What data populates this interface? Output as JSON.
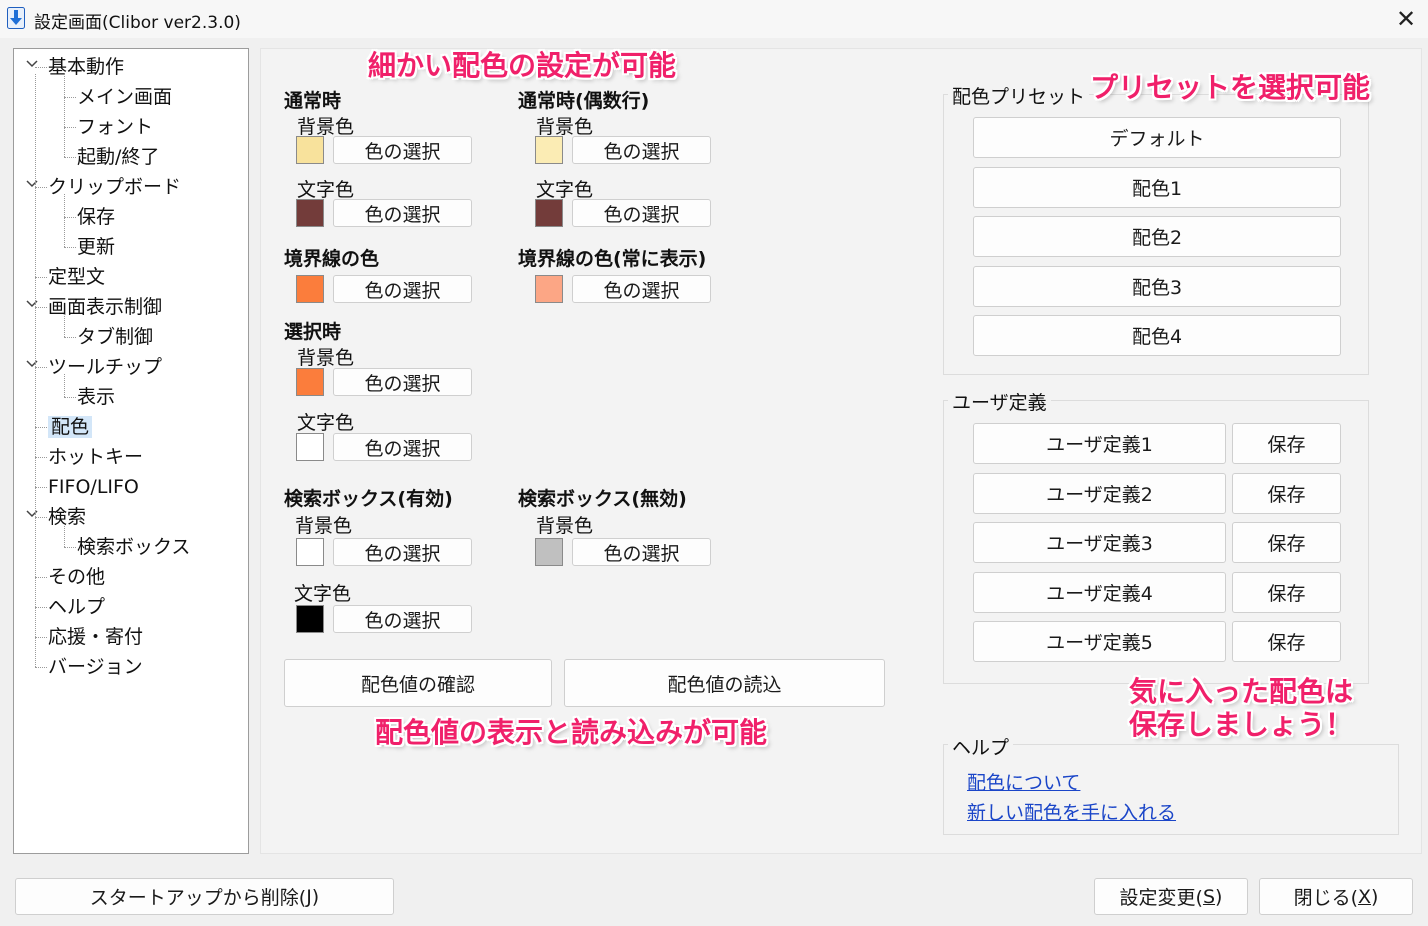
{
  "window": {
    "title": "設定画面(Clibor ver2.3.0)",
    "close_glyph": "✕"
  },
  "tree": [
    {
      "label": "基本動作",
      "level": 0,
      "expanded": true
    },
    {
      "label": "メイン画面",
      "level": 1
    },
    {
      "label": "フォント",
      "level": 1
    },
    {
      "label": "起動/終了",
      "level": 1
    },
    {
      "label": "クリップボード",
      "level": 0,
      "expanded": true
    },
    {
      "label": "保存",
      "level": 1
    },
    {
      "label": "更新",
      "level": 1
    },
    {
      "label": "定型文",
      "level": 0
    },
    {
      "label": "画面表示制御",
      "level": 0,
      "expanded": true
    },
    {
      "label": "タブ制御",
      "level": 1
    },
    {
      "label": "ツールチップ",
      "level": 0,
      "expanded": true
    },
    {
      "label": "表示",
      "level": 1
    },
    {
      "label": "配色",
      "level": 0,
      "selected": true
    },
    {
      "label": "ホットキー",
      "level": 0
    },
    {
      "label": "FIFO/LIFO",
      "level": 0
    },
    {
      "label": "検索",
      "level": 0,
      "expanded": true
    },
    {
      "label": "検索ボックス",
      "level": 1
    },
    {
      "label": "その他",
      "level": 0
    },
    {
      "label": "ヘルプ",
      "level": 0
    },
    {
      "label": "応援・寄付",
      "level": 0
    },
    {
      "label": "バージョン",
      "level": 0
    }
  ],
  "colors": {
    "normal": {
      "heading": "通常時",
      "bg_label": "背景色",
      "bg": "#f8e29c",
      "fg_label": "文字色",
      "fg": "#733c3a"
    },
    "normal_even": {
      "heading": "通常時(偶数行)",
      "bg_label": "背景色",
      "bg": "#fbecb4",
      "fg_label": "文字色",
      "fg": "#733c3a"
    },
    "border": {
      "heading": "境界線の色",
      "color": "#fb7d3c"
    },
    "border_always": {
      "heading": "境界線の色(常に表示)",
      "color": "#fca685"
    },
    "selected": {
      "heading": "選択時",
      "bg_label": "背景色",
      "bg": "#fb7d3c",
      "fg_label": "文字色",
      "fg": "#ffffff"
    },
    "search_enabled": {
      "heading": "検索ボックス(有効)",
      "bg_label": "背景色",
      "bg": "#ffffff",
      "fg_label": "文字色",
      "fg": "#000000"
    },
    "search_disabled": {
      "heading": "検索ボックス(無効)",
      "bg_label": "背景色",
      "bg": "#c0c0c0"
    },
    "choose_label": "色の選択"
  },
  "actions": {
    "confirm": "配色値の確認",
    "load": "配色値の読込"
  },
  "preset": {
    "label": "配色プリセット",
    "items": [
      "デフォルト",
      "配色1",
      "配色2",
      "配色3",
      "配色4"
    ]
  },
  "user": {
    "label": "ユーザ定義",
    "items": [
      "ユーザ定義1",
      "ユーザ定義2",
      "ユーザ定義3",
      "ユーザ定義4",
      "ユーザ定義5"
    ],
    "save_label": "保存"
  },
  "help": {
    "label": "ヘルプ",
    "links": [
      "配色について",
      "新しい配色を手に入れる"
    ]
  },
  "footer": {
    "remove_startup": {
      "text": "スタートアップから削除(",
      "key": "J",
      "tail": ")"
    },
    "apply": {
      "text": "設定変更(",
      "key": "S",
      "tail": ")"
    },
    "close": {
      "text": "閉じる(",
      "key": "X",
      "tail": ")"
    }
  },
  "annotations": {
    "fine_colors": "細かい配色の設定が可能",
    "preset_select": "プリセットを選択可能",
    "save_fav_1": "気に入った配色は",
    "save_fav_2": "保存しましょう！",
    "view_load": "配色値の表示と読み込みが可能"
  }
}
